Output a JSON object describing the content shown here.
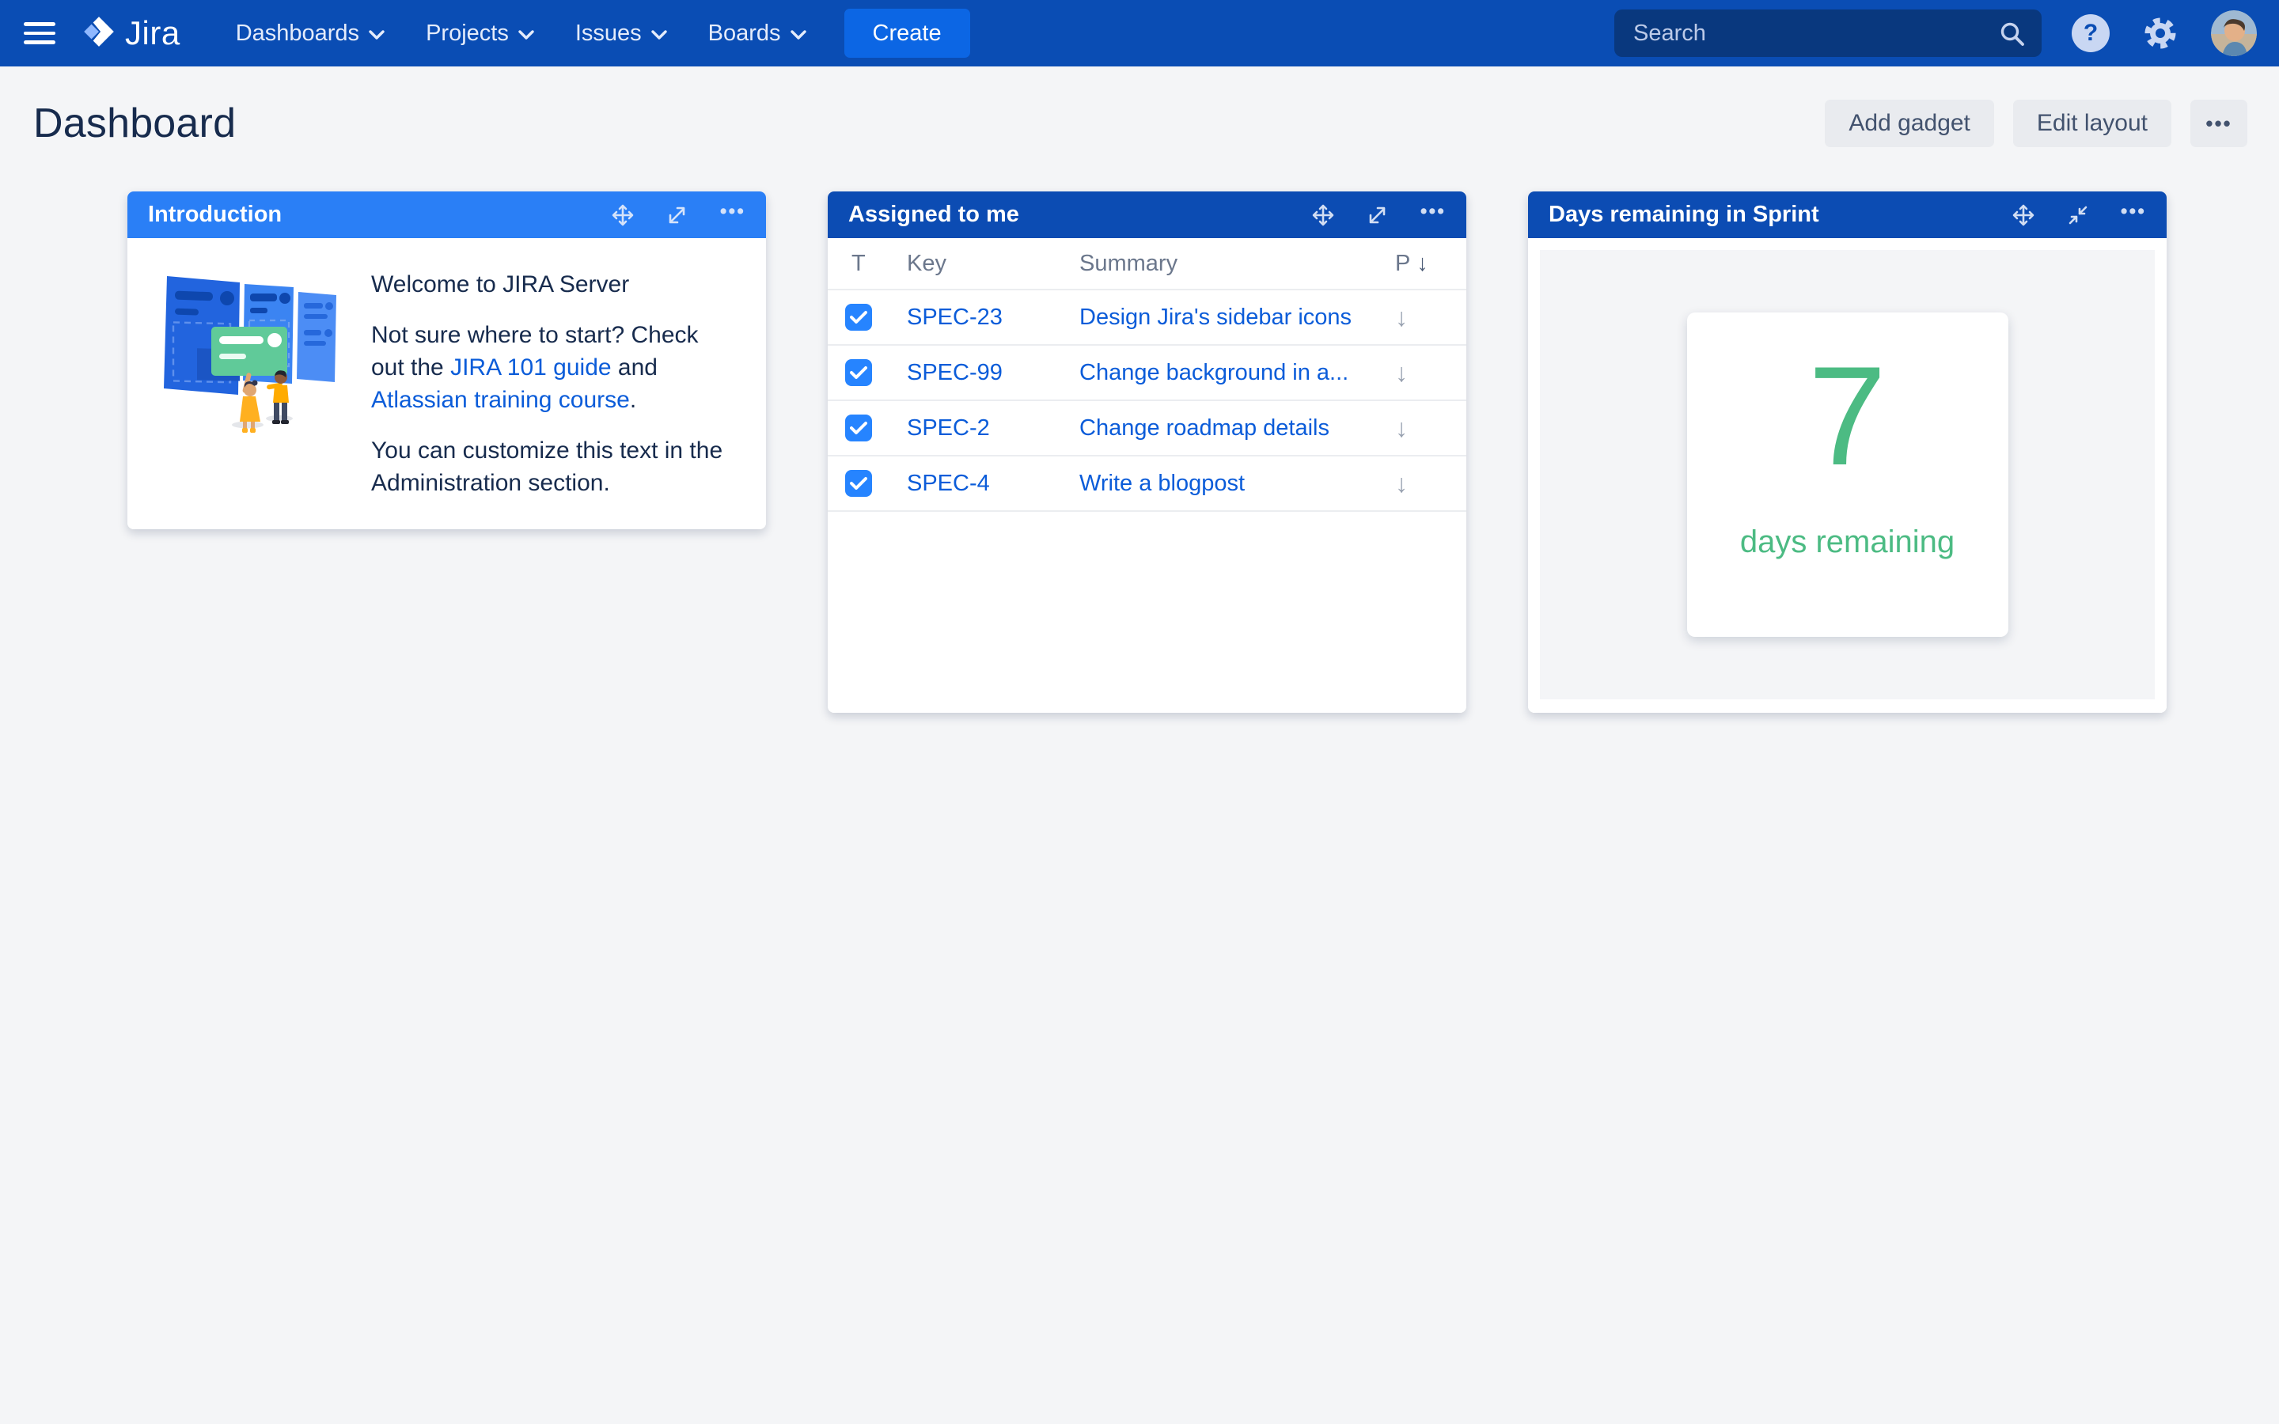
{
  "navbar": {
    "brand": "Jira",
    "menu": [
      {
        "label": "Dashboards"
      },
      {
        "label": "Projects"
      },
      {
        "label": "Issues"
      },
      {
        "label": "Boards"
      }
    ],
    "create_label": "Create",
    "search_placeholder": "Search",
    "help_glyph": "?"
  },
  "page": {
    "title": "Dashboard",
    "actions": {
      "add_gadget": "Add gadget",
      "edit_layout": "Edit layout",
      "more": "•••"
    }
  },
  "icons": {
    "ellipsis": "•••",
    "arrow_down": "↓"
  },
  "gadgets": {
    "introduction": {
      "title": "Introduction",
      "heading": "Welcome to JIRA Server",
      "p2_before": "Not sure where to start? Check out the ",
      "link_guide": "JIRA 101 guide",
      "p2_mid": " and ",
      "link_course": "Atlassian training course",
      "p2_after": ".",
      "p3": "You can customize this text in the Administration section."
    },
    "assigned": {
      "title": "Assigned to me",
      "columns": {
        "type": "T",
        "key": "Key",
        "summary": "Summary",
        "priority": "P"
      },
      "sort_icon": "↓",
      "rows": [
        {
          "key": "SPEC-23",
          "summary": "Design Jira's sidebar icons",
          "priority_icon": "↓"
        },
        {
          "key": "SPEC-99",
          "summary": "Change background in a...",
          "priority_icon": "↓"
        },
        {
          "key": "SPEC-2",
          "summary": "Change roadmap details",
          "priority_icon": "↓"
        },
        {
          "key": "SPEC-4",
          "summary": "Write a blogpost",
          "priority_icon": "↓"
        }
      ]
    },
    "sprint": {
      "title": "Days remaining in Sprint",
      "value": "7",
      "label": "days remaining"
    }
  },
  "colors": {
    "navbar_blue": "#0A4DB4",
    "create_blue": "#0C66E4",
    "gadget_header_blue": "#0C4CB3",
    "intro_header_blue": "#2A7FF6",
    "link_blue": "#0B5CD9",
    "checkbox_blue": "#2684FF",
    "green": "#4CBB83",
    "page_bg": "#F4F5F7",
    "text_dark": "#172B4D"
  }
}
